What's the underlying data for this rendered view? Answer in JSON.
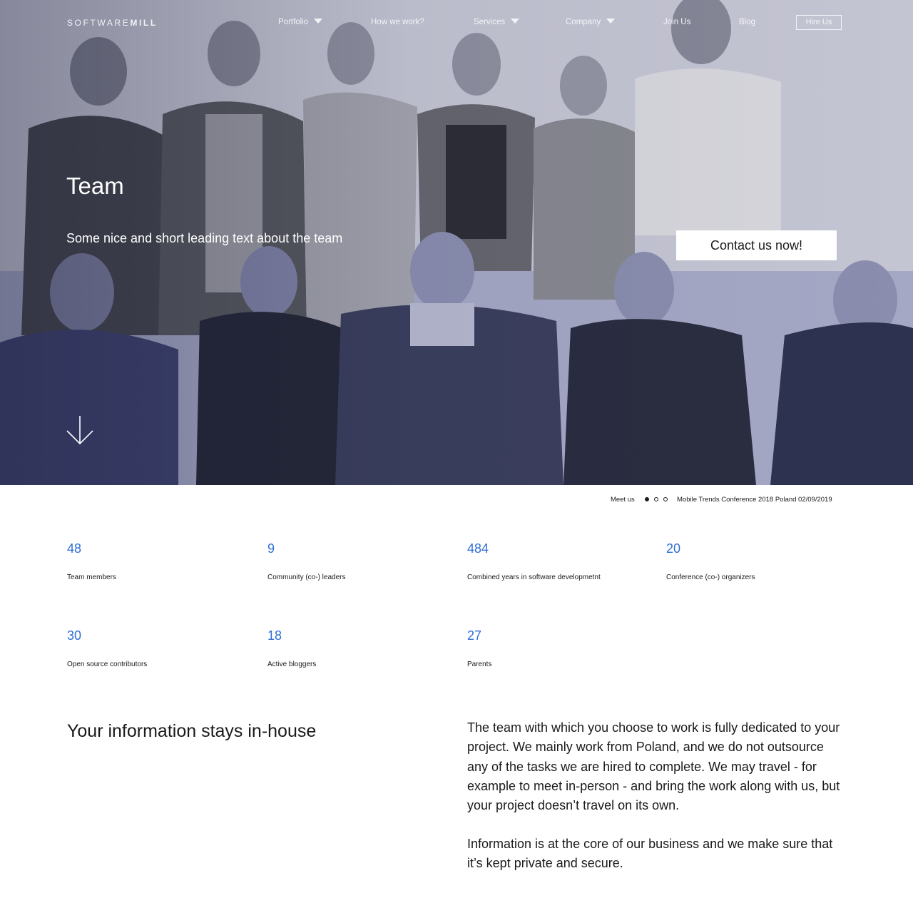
{
  "nav": {
    "logo_light": "SOFTWARE",
    "logo_bold": "MILL",
    "items": [
      {
        "label": "Portfolio",
        "dropdown": true
      },
      {
        "label": "How we work?",
        "dropdown": false
      },
      {
        "label": "Services",
        "dropdown": true
      },
      {
        "label": "Company",
        "dropdown": true
      },
      {
        "label": "Join Us",
        "dropdown": false
      },
      {
        "label": "Blog",
        "dropdown": false
      }
    ],
    "hire_label": "Hire Us"
  },
  "hero": {
    "title": "Team",
    "lead": "Some nice and short leading text about the team",
    "cta_label": "Contact us now!",
    "scroll_icon": "arrow-down-icon"
  },
  "meet_us": {
    "label": "Meet us",
    "event": "Mobile Trends Conference 2018 Poland 02/09/2019",
    "slides_total": 3,
    "active_slide": 1
  },
  "stats": [
    {
      "value": "48",
      "label": "Team members"
    },
    {
      "value": "9",
      "label": "Community (co-) leaders"
    },
    {
      "value": "484",
      "label": "Combined years in software developmetnt"
    },
    {
      "value": "20",
      "label": "Conference (co-) organizers"
    },
    {
      "value": "30",
      "label": "Open source contributors"
    },
    {
      "value": "18",
      "label": "Active bloggers"
    },
    {
      "value": "27",
      "label": "Parents"
    }
  ],
  "info": {
    "title": "Your information stays in-house",
    "paragraph1": "The team with which you choose to work is fully dedicated to your project. We mainly work from Poland, and we do not outsource any of the tasks we are hired to complete. We may travel - for example to meet in-person - and bring the work along with us, but your project doesn’t travel on its own.",
    "paragraph2": "Information is at the core of our business and we make sure that it’s kept private and secure."
  },
  "colors": {
    "accent": "#2f6fd6",
    "hero_tint": "#7a80b3"
  }
}
